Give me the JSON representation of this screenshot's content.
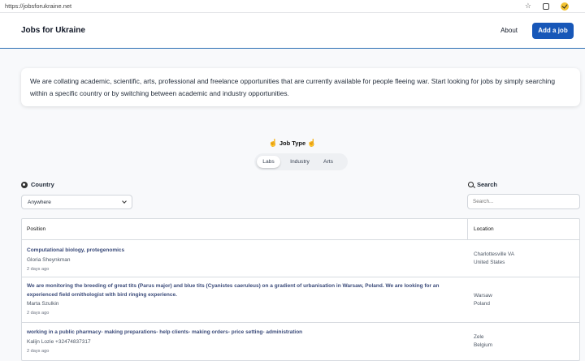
{
  "browser": {
    "url": "https://jobsforukraine.net",
    "icons": [
      "star-icon",
      "extension-icon",
      "check-badge-icon"
    ]
  },
  "header": {
    "brand": "Jobs for Ukraine",
    "about_label": "About",
    "add_job_label": "Add a job"
  },
  "intro": {
    "text": "We are collating academic, scientific, arts, professional and freelance opportunities that are currently available for people fleeing war. Start looking for jobs by simply searching within a specific country or by switching between academic and industry opportunities."
  },
  "job_type": {
    "label": "Job Type",
    "options": [
      "Labs",
      "Industry",
      "Arts"
    ],
    "selected": "Labs"
  },
  "filters": {
    "country_label": "Country",
    "country_value": "Anywhere",
    "search_label": "Search",
    "search_placeholder": "Search..."
  },
  "table": {
    "headers": {
      "position": "Position",
      "location": "Location"
    },
    "rows": [
      {
        "title": "Computational biology, protegenomics",
        "org": "Gloria Sheynkman",
        "time": "2 days ago",
        "loc1": "Charlottesville VA",
        "loc2": "United States"
      },
      {
        "title": "We are monitoring the breeding of great tits (Parus major) and blue tits (Cyanistes caeruleus) on a gradient of urbanisation in Warsaw, Poland. We are looking for an experienced field ornithologist with bird ringing experience.",
        "org": "Marta Szulkin",
        "time": "2 days ago",
        "loc1": "Warsaw",
        "loc2": "Poland"
      },
      {
        "title": "working in a public pharmacy- making preparations- help clients- making orders- price setting- administration",
        "org": "Kalijn Lozie +32474837317",
        "time": "2 days ago",
        "loc1": "Zele",
        "loc2": "Belgium"
      }
    ]
  }
}
